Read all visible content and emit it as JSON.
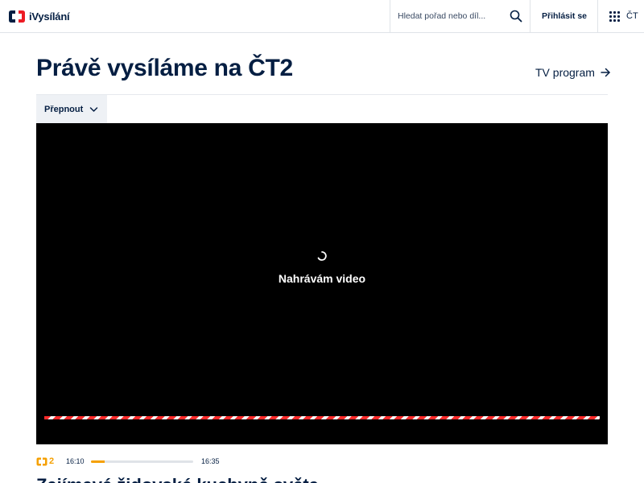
{
  "header": {
    "logo_text": "iVysílání",
    "search_placeholder": "Hledat pořad nebo díl...",
    "login_label": "Přihlásit se",
    "ct_label": "ČT"
  },
  "main": {
    "title": "Právě vysíláme na ČT2",
    "tv_program_label": "TV program",
    "switch_label": "Přepnout"
  },
  "player": {
    "loading_text": "Nahrávám video"
  },
  "broadcast": {
    "channel_label": "2",
    "start_time": "16:10",
    "end_time": "16:35",
    "progress_fraction": 0.13,
    "show_title": "Zajímavé židovské kuchyně světa"
  },
  "colors": {
    "brand_navy": "#041e42",
    "brand_red": "#ed1c24",
    "accent_orange": "#f5a000",
    "player_bg": "#000000"
  },
  "icons": {
    "logo": "ct-logo-icon",
    "search": "search-icon",
    "apps": "grid-icon",
    "arrow": "arrow-right-icon",
    "chevron": "chevron-down-icon",
    "spinner": "spinner-icon"
  }
}
